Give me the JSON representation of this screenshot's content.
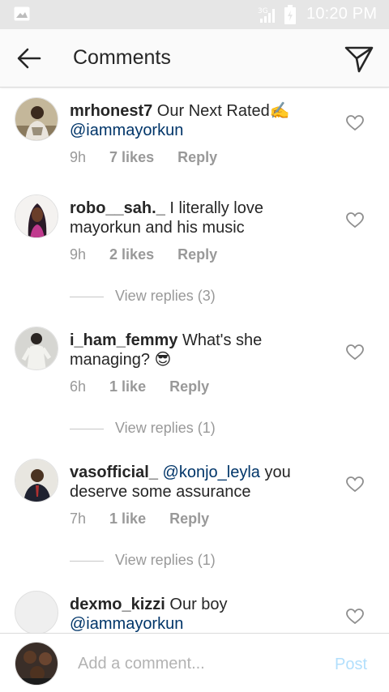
{
  "status_bar": {
    "time": "10:20 PM",
    "icons": [
      "image-icon",
      "signal-icon",
      "battery-icon"
    ]
  },
  "header": {
    "title": "Comments",
    "back_icon": "back-arrow-icon",
    "send_icon": "send-icon"
  },
  "comments": [
    {
      "username": "mrhonest7",
      "text": " Our Next Rated✍️",
      "mention": "@iammayorkun",
      "after": "",
      "time": "9h",
      "likes": "7 likes",
      "reply": "Reply"
    },
    {
      "username": "robo__sah._",
      "text": " I literally love mayorkun and his music",
      "mention": "",
      "after": "",
      "time": "9h",
      "likes": "2 likes",
      "reply": "Reply",
      "view_replies": "View replies (3)"
    },
    {
      "username": "i_ham_femmy",
      "text": " What's she managing? 😎",
      "mention": "",
      "after": "",
      "time": "6h",
      "likes": "1 like",
      "reply": "Reply",
      "view_replies": "View replies (1)"
    },
    {
      "username": "vasofficial_",
      "text": " ",
      "mention": "@konjo_leyla",
      "after": " you deserve some assurance",
      "time": "7h",
      "likes": "1 like",
      "reply": "Reply",
      "view_replies": "View replies (1)"
    },
    {
      "username": "dexmo_kizzi",
      "text": " Our boy",
      "mention": "@iammayorkun",
      "after": ""
    }
  ],
  "composer": {
    "placeholder": "Add a comment...",
    "post_label": "Post"
  },
  "colors": {
    "mention": "#003569",
    "meta": "#999999",
    "post_disabled": "#b2dffc"
  }
}
